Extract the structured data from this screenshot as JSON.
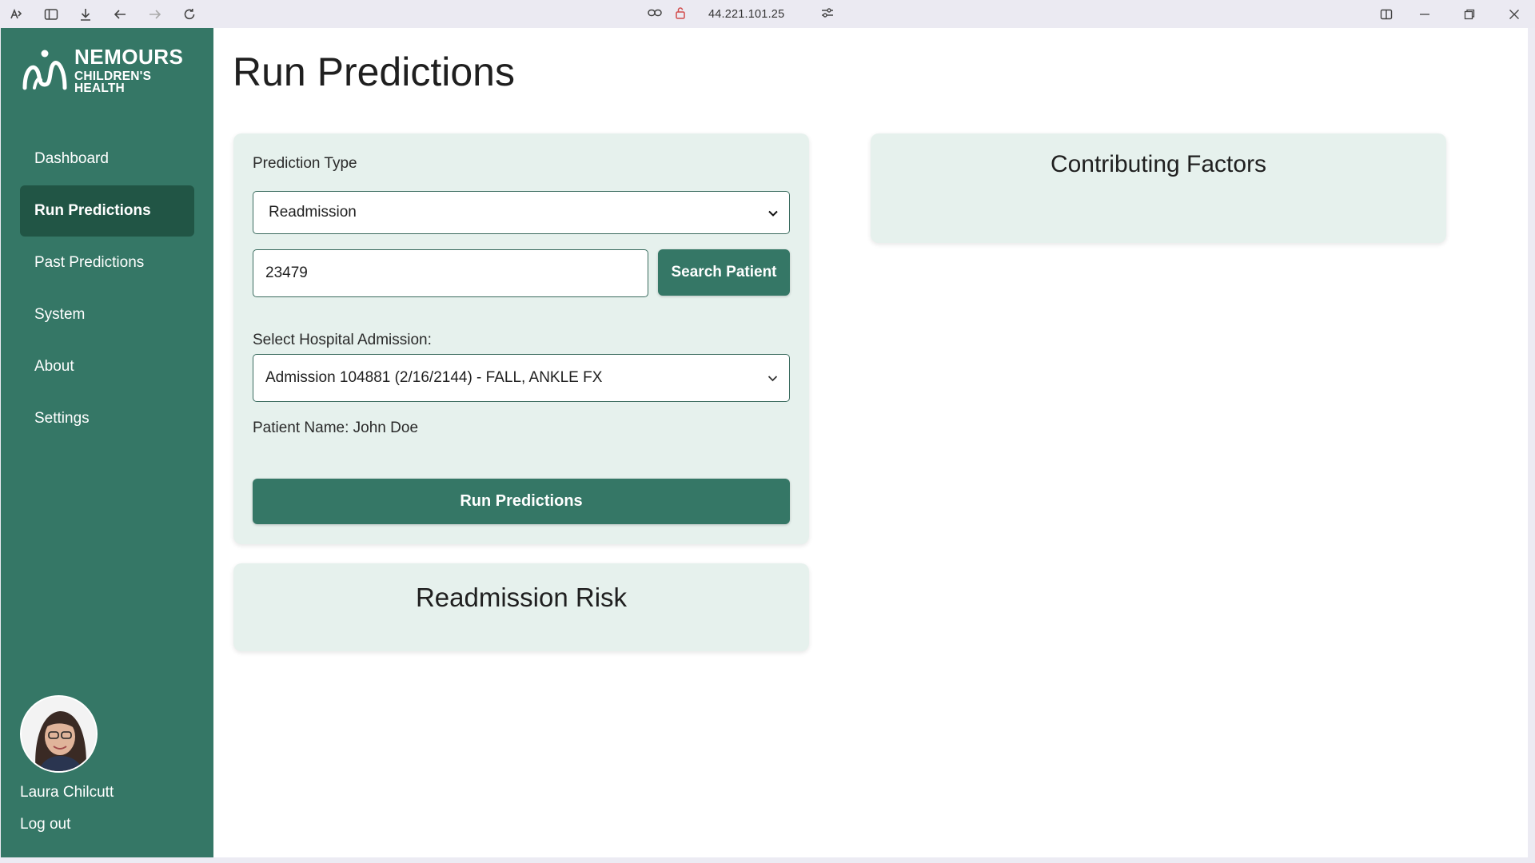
{
  "browser": {
    "url": "44.221.101.25",
    "icons": [
      "extensions-icon",
      "sidebar-icon",
      "download-icon",
      "back-icon",
      "forward-icon",
      "reload-icon",
      "link-icon",
      "lock-icon",
      "site-settings-icon",
      "split-view-icon",
      "minimize-icon",
      "restore-icon",
      "close-icon"
    ]
  },
  "logo": {
    "line1": "NEMOURS",
    "line2": "CHILDREN'S HEALTH"
  },
  "sidebar": {
    "items": [
      {
        "label": "Dashboard",
        "active": false
      },
      {
        "label": "Run Predictions",
        "active": true
      },
      {
        "label": "Past Predictions",
        "active": false
      },
      {
        "label": "System",
        "active": false
      },
      {
        "label": "About",
        "active": false
      },
      {
        "label": "Settings",
        "active": false
      }
    ],
    "user": {
      "name": "Laura Chilcutt",
      "logout": "Log out"
    }
  },
  "main": {
    "title": "Run Predictions",
    "form": {
      "prediction_type_label": "Prediction Type",
      "prediction_type_value": "Readmission",
      "patient_id_value": "23479",
      "search_button": "Search Patient",
      "admission_label": "Select Hospital Admission:",
      "admission_value": "Admission 104881 (2/16/2144) - FALL, ANKLE FX",
      "patient_name": "Patient Name: John Doe",
      "run_button": "Run Predictions"
    },
    "risk_card_title": "Readmission Risk",
    "factors_card_title": "Contributing Factors"
  },
  "colors": {
    "sidebar": "#357766",
    "sidebar_active": "#215545",
    "card": "#e6f1ed",
    "button": "#357766"
  }
}
